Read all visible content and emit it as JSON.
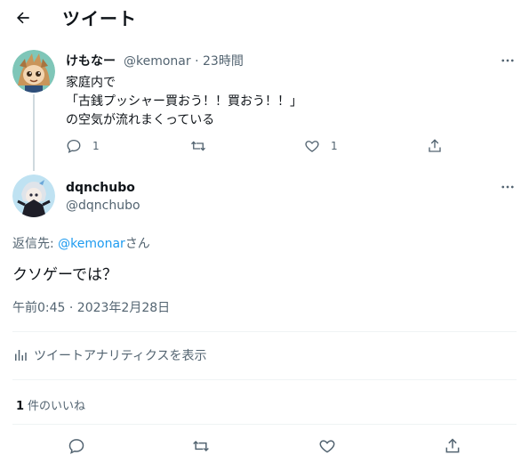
{
  "header": {
    "title": "ツイート"
  },
  "parent_tweet": {
    "display_name": "けもなー",
    "handle": "@kemonar",
    "separator": " · ",
    "time": "23時間",
    "text_lines": [
      "家庭内で",
      "「古銭プッシャー買おう！！買おう！！」",
      "の空気が流れまくっている"
    ],
    "reply_count": "1",
    "like_count": "1"
  },
  "main_tweet": {
    "display_name": "dqnchubo",
    "handle": "@dqnchubo",
    "reply_prefix": "返信先: ",
    "reply_handle": "@kemonar",
    "reply_suffix": "さん",
    "text": "クソゲーでは？",
    "timestamp": "午前0:45 · 2023年2月28日",
    "analytics_label": "ツイートアナリティクスを表示",
    "like_count": "1",
    "like_label": "件のいいね"
  },
  "colors": {
    "link": "#1d9bf0",
    "text": "#0f1419",
    "muted": "#536471",
    "divider": "#eff3f4"
  },
  "icons": [
    "back-arrow-icon",
    "more-icon",
    "reply-icon",
    "retweet-icon",
    "like-icon",
    "share-icon",
    "analytics-icon"
  ]
}
